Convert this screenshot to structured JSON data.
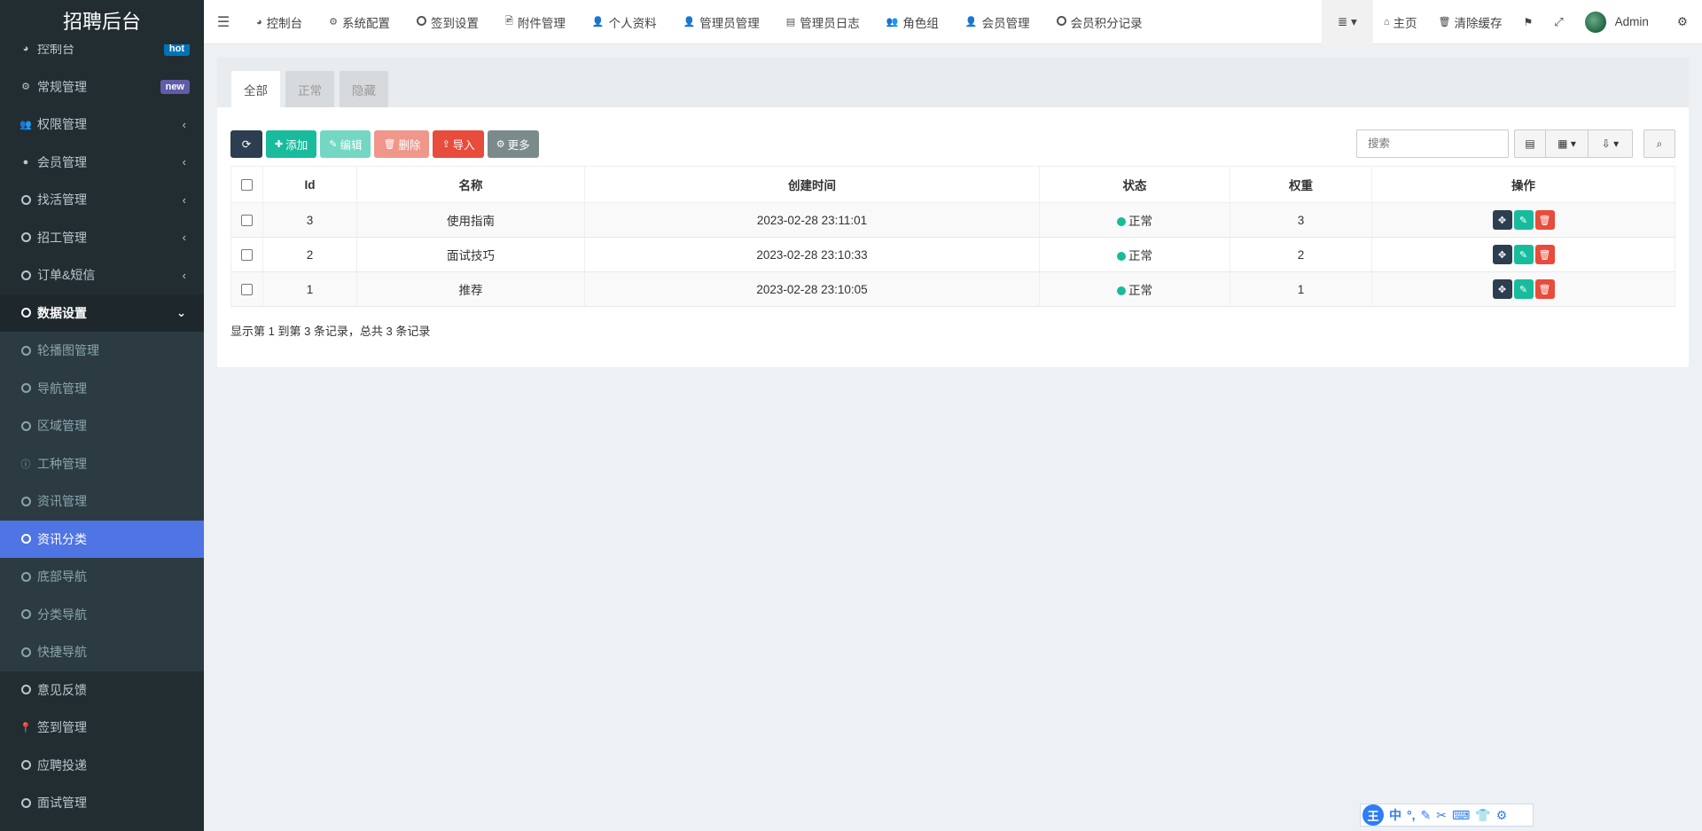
{
  "app": {
    "title": "招聘后台"
  },
  "sidebar": {
    "items": [
      {
        "label": "控制台",
        "icon": "dashboard-icon",
        "badge": "hot"
      },
      {
        "label": "常规管理",
        "icon": "cogs-icon",
        "badge": "new"
      },
      {
        "label": "权限管理",
        "icon": "users-icon"
      },
      {
        "label": "会员管理",
        "icon": "user-circle-icon"
      },
      {
        "label": "找活管理",
        "icon": "circle-icon"
      },
      {
        "label": "招工管理",
        "icon": "circle-icon"
      },
      {
        "label": "订单&短信",
        "icon": "circle-icon"
      },
      {
        "label": "数据设置",
        "icon": "circle-icon"
      }
    ],
    "sub_items": [
      {
        "label": "轮播图管理"
      },
      {
        "label": "导航管理"
      },
      {
        "label": "区域管理"
      },
      {
        "label": "工种管理"
      },
      {
        "label": "资讯管理"
      },
      {
        "label": "资讯分类"
      },
      {
        "label": "底部导航"
      },
      {
        "label": "分类导航"
      },
      {
        "label": "快捷导航"
      }
    ],
    "bottom_items": [
      {
        "label": "意见反馈"
      },
      {
        "label": "签到管理"
      },
      {
        "label": "应聘投递"
      },
      {
        "label": "面试管理"
      }
    ]
  },
  "topbar": {
    "nav": [
      "控制台",
      "系统配置",
      "签到设置",
      "附件管理",
      "个人资料",
      "管理员管理",
      "管理员日志",
      "角色组",
      "会员管理",
      "会员积分记录"
    ],
    "home": "主页",
    "clear_cache": "清除缓存",
    "user": "Admin"
  },
  "tabs": [
    "全部",
    "正常",
    "隐藏"
  ],
  "toolbar": {
    "add": "添加",
    "edit": "编辑",
    "delete": "删除",
    "import": "导入",
    "more": "更多",
    "search_placeholder": "搜索"
  },
  "table": {
    "columns": [
      "Id",
      "名称",
      "创建时间",
      "状态",
      "权重",
      "操作"
    ],
    "rows": [
      {
        "id": "3",
        "name": "使用指南",
        "created": "2023-02-28 23:11:01",
        "status": "正常",
        "weight": "3"
      },
      {
        "id": "2",
        "name": "面试技巧",
        "created": "2023-02-28 23:10:33",
        "status": "正常",
        "weight": "2"
      },
      {
        "id": "1",
        "name": "推荐",
        "created": "2023-02-28 23:10:05",
        "status": "正常",
        "weight": "1"
      }
    ]
  },
  "pagination": {
    "info": "显示第 1 到第 3 条记录，总共 3 条记录"
  },
  "ime": {
    "logo": "王",
    "lang": "中"
  },
  "colors": {
    "sidebar": "#222d32",
    "active": "#4f74e3",
    "green": "#18bc9c",
    "red": "#e74c3c",
    "dark": "#2c3e50"
  }
}
